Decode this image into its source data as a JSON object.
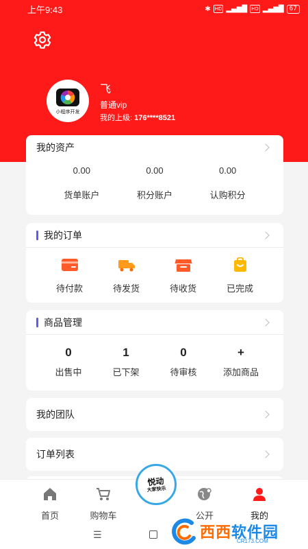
{
  "status_bar": {
    "time": "上午9:43",
    "signal_tags": [
      "HD",
      "HD"
    ],
    "battery": "67"
  },
  "user": {
    "name": "飞",
    "level": "普通vip",
    "superior_label": "我的上级: ",
    "superior_value": "176****8521",
    "avatar_caption": "小程序开发"
  },
  "assets": {
    "title": "我的资产",
    "items": [
      {
        "value": "0.00",
        "label": "货单账户"
      },
      {
        "value": "0.00",
        "label": "积分账户"
      },
      {
        "value": "0.00",
        "label": "认购积分"
      }
    ]
  },
  "orders": {
    "title": "我的订单",
    "items": [
      {
        "label": "待付款",
        "icon": "card-icon"
      },
      {
        "label": "待发货",
        "icon": "truck-icon"
      },
      {
        "label": "待收货",
        "icon": "store-icon"
      },
      {
        "label": "已完成",
        "icon": "bag-icon"
      }
    ]
  },
  "goods": {
    "title": "商品管理",
    "items": [
      {
        "value": "0",
        "label": "出售中"
      },
      {
        "value": "1",
        "label": "已下架"
      },
      {
        "value": "0",
        "label": "待审核"
      },
      {
        "value": "+",
        "label": "添加商品"
      }
    ]
  },
  "menu": {
    "team": "我的团队",
    "order_list": "订单列表"
  },
  "tabbar": {
    "home": "首页",
    "cart": "购物车",
    "public": "公开",
    "mine": "我的",
    "center_line1": "悦动",
    "center_line2": "大家快乐"
  },
  "navbar": {
    "menu_glyph": "☰"
  },
  "watermark": {
    "text_a": "西西",
    "text_b": "软件园",
    "url": "CR173.COM"
  },
  "colors": {
    "header_red": "#ff1a1a",
    "accent_purple": "#5b5bf5",
    "icon_orange": "#ff5a2a",
    "icon_yellow": "#ffb900",
    "mine_red": "#ff1a1a",
    "center_border": "#38a7e6"
  }
}
